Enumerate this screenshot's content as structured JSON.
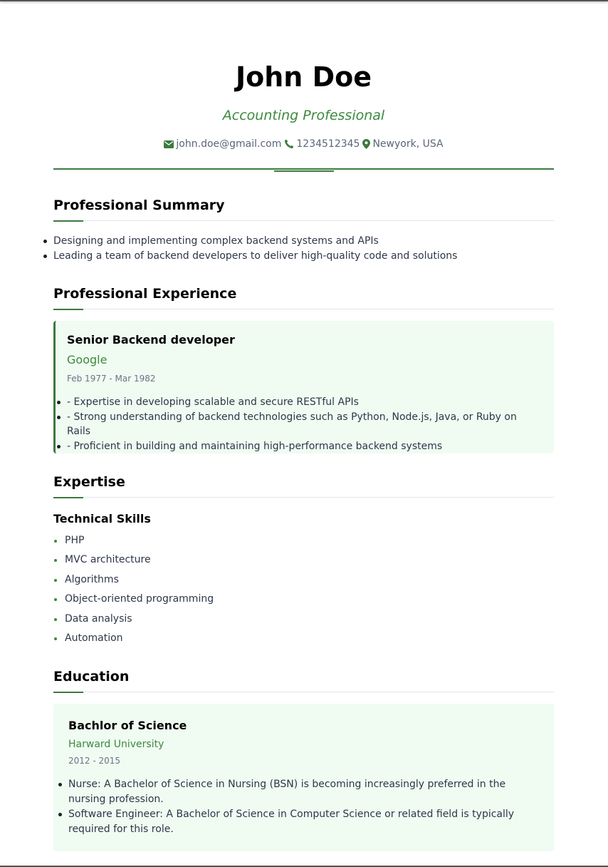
{
  "header": {
    "name": "John Doe",
    "title": "Accounting Professional",
    "email": "john.doe@gmail.com",
    "phone": "1234512345",
    "location": "Newyork, USA"
  },
  "summary": {
    "heading": "Professional Summary",
    "items": [
      "Designing and implementing complex backend systems and APIs",
      "Leading a team of backend developers to deliver high-quality code and solutions"
    ]
  },
  "experience": {
    "heading": "Professional Experience",
    "jobs": [
      {
        "role": "Senior Backend developer",
        "company": "Google",
        "dates": "Feb 1977 - Mar 1982",
        "points": [
          "- Expertise in developing scalable and secure RESTful APIs",
          "- Strong understanding of backend technologies such as Python, Node.js, Java, or Ruby on Rails",
          "- Proficient in building and maintaining high-performance backend systems"
        ]
      }
    ]
  },
  "expertise": {
    "heading": "Expertise",
    "group_title": "Technical Skills",
    "skills": [
      "PHP",
      "MVC architecture",
      "Algorithms",
      "Object-oriented programming",
      "Data analysis",
      "Automation"
    ]
  },
  "education": {
    "heading": "Education",
    "entries": [
      {
        "degree": "Bachlor of Science",
        "school": "Harward University",
        "dates": "2012 - 2015",
        "points": [
          "Nurse: A Bachelor of Science in Nursing (BSN) is becoming increasingly preferred in the nursing profession.",
          "Software Engineer: A Bachelor of Science in Computer Science or related field is typically required for this role."
        ]
      }
    ]
  },
  "icons": {
    "email": "envelope-icon",
    "phone": "phone-icon",
    "location": "map-pin-icon"
  },
  "colors": {
    "accent": "#3b7a3e",
    "accent_text": "#3b8a3e",
    "card_bg": "#f0fbf2",
    "muted": "#6b7385"
  }
}
